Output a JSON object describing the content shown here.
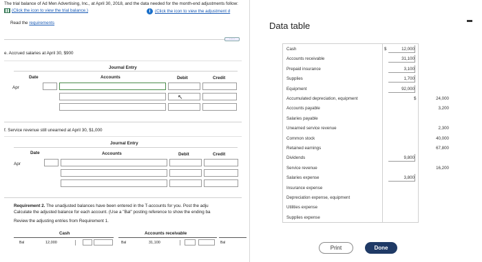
{
  "question": {
    "intro": "The trial balance of Ad Men Advertising, Inc., at April 30, 2018, and the data needed for the month-end adjustments follow:",
    "trial_balance_link": "(Click the icon to view the trial balance.)",
    "adjustment_link": "(Click the icon to view the adjustment d",
    "read_requirements_prefix": "Read the ",
    "read_requirements_link": "requirements",
    "ellipsis": "·····",
    "part_e": {
      "label": "e. Accrued salaries at April 30, $900",
      "journal_entry": "Journal Entry",
      "date_header": "Date",
      "accounts_header": "Accounts",
      "debit_header": "Debit",
      "credit_header": "Credit",
      "month": "Apr"
    },
    "part_f": {
      "label": "f. Service revenue still unearned at April 30, $1,000",
      "journal_entry": "Journal Entry",
      "date_header": "Date",
      "accounts_header": "Accounts",
      "debit_header": "Debit",
      "credit_header": "Credit",
      "month": "Apr"
    },
    "requirement2": {
      "title": "Requirement 2.",
      "text1": " The unadjusted balances have been entered in the T-accounts for you. Post the adju",
      "text2": "Calculate the adjusted balance for each account. (Use a \"Bal\" posting reference to show the ending ba",
      "text3": "Review the adjusting entries from Requirement 1."
    },
    "t_accounts": {
      "cash_title": "Cash",
      "ar_title": "Accounts receivable",
      "bal_label": "Bal",
      "cash_bal": "12,000",
      "ar_bal": "31,100"
    }
  },
  "modal": {
    "title": "Data table",
    "accounts": [
      {
        "name": "Cash",
        "debit": "12,000",
        "credit": "",
        "debit_dollar": true,
        "credit_dollar": false
      },
      {
        "name": "Accounts receivable",
        "debit": "31,100",
        "credit": ""
      },
      {
        "name": "Prepaid insurance",
        "debit": "3,100",
        "credit": ""
      },
      {
        "name": "Supplies",
        "debit": "1,700",
        "credit": ""
      },
      {
        "name": "Equipment",
        "debit": "92,000",
        "credit": ""
      },
      {
        "name": "Accumulated depreciation, equipment",
        "debit": "",
        "credit": "24,000",
        "credit_dollar": true
      },
      {
        "name": "Accounts payable",
        "debit": "",
        "credit": "3,200"
      },
      {
        "name": "Salaries payable",
        "debit": "",
        "credit": ""
      },
      {
        "name": "Unearned service revenue",
        "debit": "",
        "credit": "2,300"
      },
      {
        "name": "Common stock",
        "debit": "",
        "credit": "40,000"
      },
      {
        "name": "Retained earnings",
        "debit": "",
        "credit": "67,800"
      },
      {
        "name": "Dividends",
        "debit": "9,800",
        "credit": ""
      },
      {
        "name": "Service revenue",
        "debit": "",
        "credit": "16,200"
      },
      {
        "name": "Salaries expense",
        "debit": "3,800",
        "credit": ""
      },
      {
        "name": "Insurance expense",
        "debit": "",
        "credit": ""
      },
      {
        "name": "Depreciation expense, equipment",
        "debit": "",
        "credit": ""
      },
      {
        "name": "Utilities expense",
        "debit": "",
        "credit": ""
      },
      {
        "name": "Supplies expense",
        "debit": "",
        "credit": ""
      }
    ],
    "dollar_sign": "$",
    "print_label": "Print",
    "done_label": "Done"
  }
}
